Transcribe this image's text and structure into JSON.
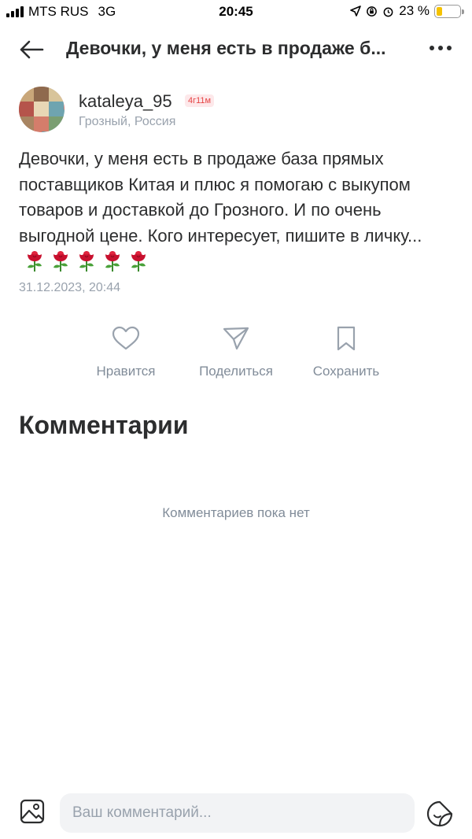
{
  "status_bar": {
    "carrier": "MTS RUS",
    "network": "3G",
    "time": "20:45",
    "battery": "23 %",
    "battery_level": 0.23
  },
  "header": {
    "title": "Девочки, у меня есть в продаже б..."
  },
  "author": {
    "username": "kataleya_95",
    "badge": "4г11м",
    "location": "Грозный, Россия"
  },
  "post": {
    "text": "Девочки, у меня есть в продаже база прямых поставщиков Китая и плюс я помогаю с выкупом товаров и доставкой до Грозного. И по очень выгодной цене. Кого интересует, пишите в личку...",
    "emoji_name": "rose-icon",
    "emoji_count": 5,
    "date": "31.12.2023, 20:44"
  },
  "actions": {
    "like_label": "Нравится",
    "share_label": "Поделиться",
    "save_label": "Сохранить"
  },
  "comments": {
    "title": "Комментарии",
    "empty_text": "Комментариев пока нет"
  },
  "composer": {
    "placeholder": "Ваш комментарий..."
  },
  "colors": {
    "text": "#2c2d2e",
    "secondary": "#818c99",
    "badge_text": "#e64646",
    "badge_bg": "#fde8ea",
    "input_bg": "#f2f3f5"
  }
}
